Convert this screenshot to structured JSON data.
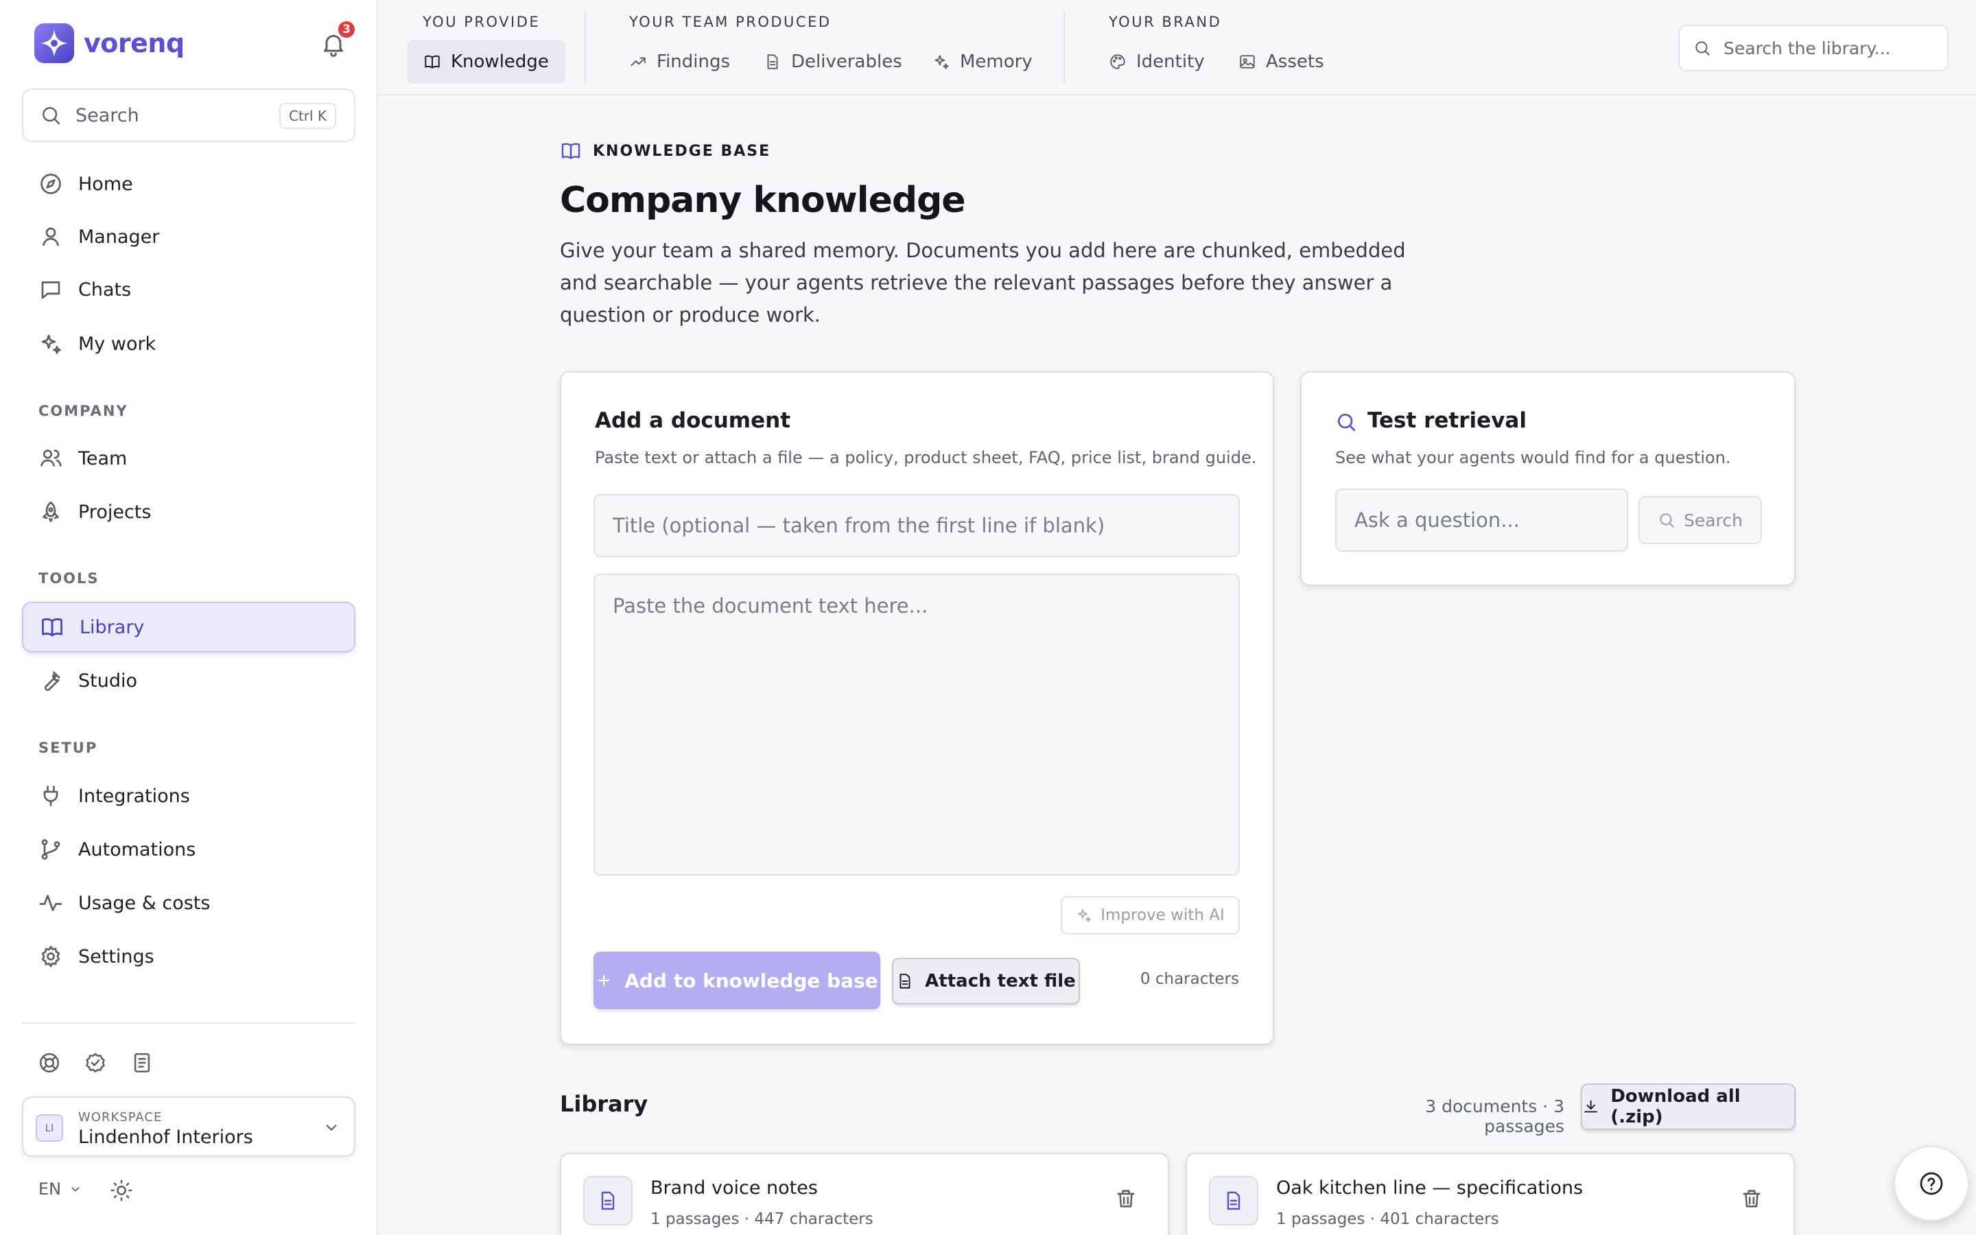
{
  "brand": {
    "name": "vorenq",
    "notification_count": "3"
  },
  "sidebar": {
    "search_label": "Search",
    "search_shortcut": "Ctrl K",
    "main_items": [
      {
        "label": "Home",
        "icon": "compass-icon"
      },
      {
        "label": "Manager",
        "icon": "user-icon"
      },
      {
        "label": "Chats",
        "icon": "chat-bubble-icon"
      },
      {
        "label": "My work",
        "icon": "sparkles-icon"
      }
    ],
    "sections": [
      {
        "label": "COMPANY",
        "items": [
          {
            "label": "Team",
            "icon": "users-icon"
          },
          {
            "label": "Projects",
            "icon": "rocket-icon"
          }
        ]
      },
      {
        "label": "TOOLS",
        "items": [
          {
            "label": "Library",
            "icon": "book-open-icon",
            "active": true
          },
          {
            "label": "Studio",
            "icon": "wrench-icon"
          }
        ]
      },
      {
        "label": "SETUP",
        "items": [
          {
            "label": "Integrations",
            "icon": "plug-icon"
          },
          {
            "label": "Automations",
            "icon": "git-branch-icon"
          },
          {
            "label": "Usage & costs",
            "icon": "activity-icon"
          },
          {
            "label": "Settings",
            "icon": "gear-icon"
          }
        ]
      }
    ],
    "workspace": {
      "label": "WORKSPACE",
      "initials": "LI",
      "name": "Lindenhof Interiors"
    },
    "language": "EN"
  },
  "topbar": {
    "groups": [
      {
        "label": "YOU PROVIDE",
        "items": [
          {
            "label": "Knowledge",
            "icon": "book-open-icon",
            "active": true
          }
        ]
      },
      {
        "label": "YOUR TEAM PRODUCED",
        "items": [
          {
            "label": "Findings",
            "icon": "trending-up-icon"
          },
          {
            "label": "Deliverables",
            "icon": "file-icon"
          },
          {
            "label": "Memory",
            "icon": "sparkles-icon"
          }
        ]
      },
      {
        "label": "YOUR BRAND",
        "items": [
          {
            "label": "Identity",
            "icon": "palette-icon"
          },
          {
            "label": "Assets",
            "icon": "image-icon"
          }
        ]
      }
    ],
    "search_placeholder": "Search the library..."
  },
  "page": {
    "eyebrow": "KNOWLEDGE BASE",
    "title": "Company knowledge",
    "description": "Give your team a shared memory. Documents you add here are chunked, embedded and searchable — your agents retrieve the relevant passages before they answer a question or produce work."
  },
  "add_document": {
    "title": "Add a document",
    "subtitle": "Paste text or attach a file — a policy, product sheet, FAQ, price list, brand guide.",
    "title_placeholder": "Title (optional — taken from the first line if blank)",
    "title_value": "",
    "body_placeholder": "Paste the document text here...",
    "body_value": "",
    "improve_label": "Improve with AI",
    "add_label": "Add to knowledge base",
    "attach_label": "Attach text file",
    "char_count": "0 characters"
  },
  "test_retrieval": {
    "title": "Test retrieval",
    "subtitle": "See what your agents would find for a question.",
    "question_placeholder": "Ask a question...",
    "question_value": "",
    "search_label": "Search"
  },
  "library": {
    "title": "Library",
    "stats": "3 documents · 3 passages",
    "download_label": "Download all (.zip)",
    "documents": [
      {
        "title": "Brand voice notes",
        "meta": "1 passages · 447 characters"
      },
      {
        "title": "Oak kitchen line — specifications",
        "meta": "1 passages · 401 characters"
      }
    ]
  },
  "colors": {
    "accent": "#5b4fd8",
    "accent_soft": "#ecebfb",
    "badge": "#e23b3b",
    "disabled_primary": "#b3aef0"
  }
}
